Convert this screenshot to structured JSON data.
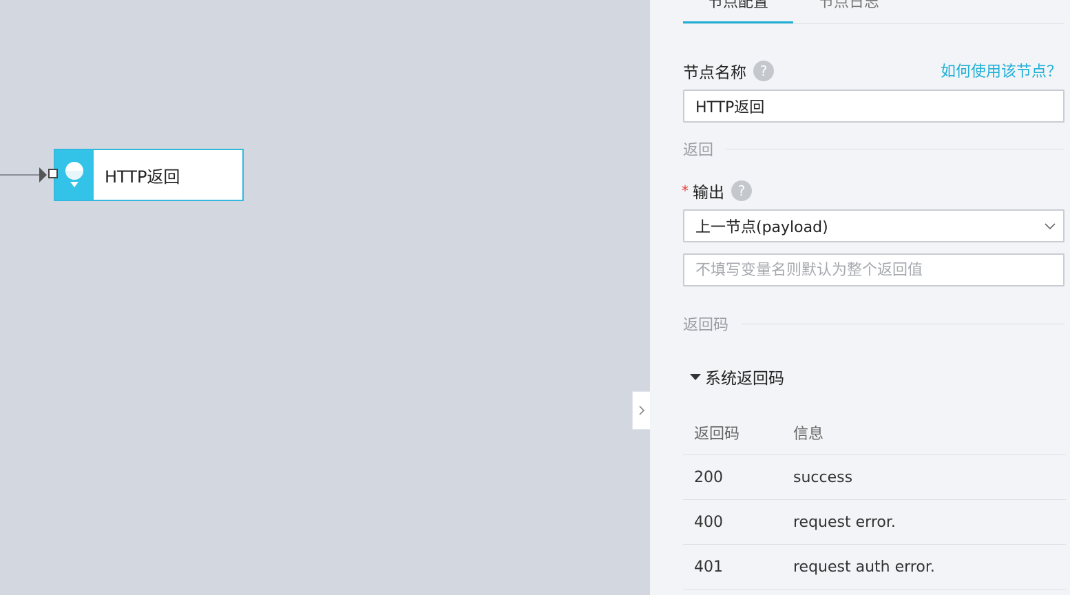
{
  "canvas": {
    "node": {
      "label": "HTTP返回",
      "icon": "bulb-icon",
      "accent": "#33c3e8"
    }
  },
  "panel": {
    "tabs": [
      {
        "label": "节点配置",
        "active": true
      },
      {
        "label": "节点日志",
        "active": false
      }
    ],
    "node_name": {
      "label": "节点名称",
      "help_link": "如何使用该节点？",
      "value": "HTTP返回"
    },
    "section_return": "返回",
    "output": {
      "required_mark": "*",
      "label": "输出",
      "selected": "上一节点(payload)",
      "var_placeholder": "不填写变量名则默认为整个返回值"
    },
    "section_return_code": "返回码",
    "system_codes": {
      "title": "系统返回码",
      "headers": [
        "返回码",
        "信息"
      ],
      "rows": [
        [
          "200",
          "success"
        ],
        [
          "400",
          "request error."
        ],
        [
          "401",
          "request auth error."
        ]
      ]
    }
  },
  "colors": {
    "accent": "#1fb0d8",
    "required": "#e53935"
  }
}
